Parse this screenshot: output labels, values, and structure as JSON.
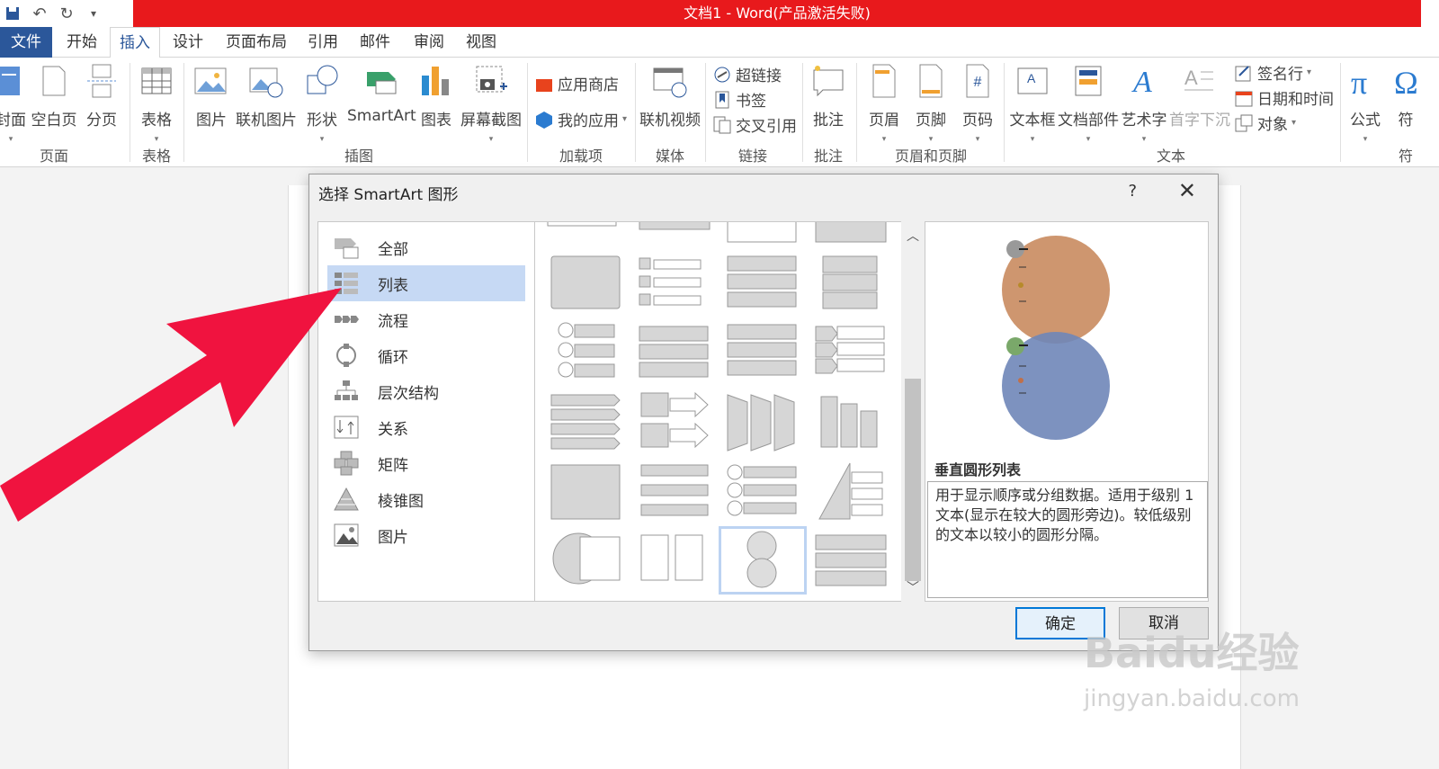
{
  "window": {
    "title": "文档1 - Word(产品激活失败)"
  },
  "tabs": [
    "文件",
    "开始",
    "插入",
    "设计",
    "页面布局",
    "引用",
    "邮件",
    "审阅",
    "视图"
  ],
  "ribbon": {
    "pages_group": {
      "label": "页面",
      "buttons": [
        "封面",
        "空白页",
        "分页"
      ]
    },
    "table_group": {
      "label": "表格",
      "buttons": [
        "表格"
      ]
    },
    "illustrations_group": {
      "label": "插图",
      "buttons": [
        "图片",
        "联机图片",
        "形状",
        "SmartArt",
        "图表",
        "屏幕截图"
      ]
    },
    "addins_group": {
      "label": "加载项",
      "buttons": [
        "应用商店",
        "我的应用"
      ]
    },
    "media_group": {
      "label": "媒体",
      "buttons": [
        "联机视频"
      ]
    },
    "links_group": {
      "label": "链接",
      "buttons": [
        "超链接",
        "书签",
        "交叉引用"
      ]
    },
    "comments_group": {
      "label": "批注",
      "buttons": [
        "批注"
      ]
    },
    "header_footer_group": {
      "label": "页眉和页脚",
      "buttons": [
        "页眉",
        "页脚",
        "页码"
      ]
    },
    "text_group": {
      "label": "文本",
      "buttons": [
        "文本框",
        "文档部件",
        "艺术字",
        "首字下沉",
        "签名行",
        "日期和时间",
        "对象"
      ]
    },
    "symbols_group": {
      "label": "符",
      "buttons": [
        "公式",
        "符"
      ]
    }
  },
  "dialog": {
    "title": "选择 SmartArt 图形",
    "help": "?",
    "categories": [
      "全部",
      "列表",
      "流程",
      "循环",
      "层次结构",
      "关系",
      "矩阵",
      "棱锥图",
      "图片"
    ],
    "selected_category": "列表",
    "preview": {
      "name": "垂直圆形列表",
      "description": "用于显示顺序或分组数据。适用于级别 1 文本(显示在较大的圆形旁边)。较低级别的文本以较小的圆形分隔。"
    },
    "ok": "确定",
    "cancel": "取消"
  },
  "watermark": {
    "brand": "Baidu经验",
    "url": "jingyan.baidu.com"
  },
  "colors": {
    "title_red": "#e8191c",
    "file_blue": "#2b579a",
    "selection": "#c6d9f4",
    "arrow": "#f0133f"
  }
}
